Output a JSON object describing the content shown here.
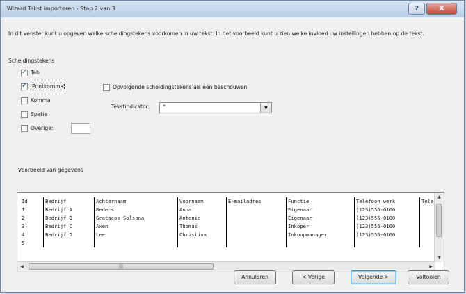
{
  "window": {
    "title": "Wizard Tekst importeren - Stap 2 van 3",
    "help_label": "?",
    "close_label": "X"
  },
  "description": "In dit venster kunt u opgeven welke scheidingstekens voorkomen in uw tekst. In het voorbeeld kunt u zien welke invloed uw instellingen hebben op de tekst.",
  "delimiters": {
    "group_label": "Scheidingstekens",
    "items": [
      {
        "label": "Tab",
        "checked": true
      },
      {
        "label": "Puntkomma",
        "checked": true
      },
      {
        "label": "Komma",
        "checked": false
      },
      {
        "label": "Spatie",
        "checked": false
      },
      {
        "label": "Overige:",
        "checked": false
      }
    ],
    "other_value": ""
  },
  "consecutive": {
    "label": "Opvolgende scheidingstekens als één beschouwen",
    "checked": false
  },
  "text_qualifier": {
    "label": "Tekstindicator:",
    "value": "\""
  },
  "preview": {
    "label": "Voorbeeld van gegevens",
    "columns": [
      {
        "cells": [
          "Id",
          "1",
          "2",
          "3",
          "4",
          "5"
        ]
      },
      {
        "cells": [
          "Bedrijf",
          "Bedrijf A",
          "Bedrijf B",
          "Bedrijf C",
          "Bedrijf D",
          ""
        ]
      },
      {
        "cells": [
          "Achternaam",
          "Bedecs",
          "Gratacos Solsona",
          "Axen",
          "Lee",
          ""
        ]
      },
      {
        "cells": [
          "Voornaam",
          "Anna",
          "Antonio",
          "Thomas",
          "Christina",
          ""
        ]
      },
      {
        "cells": [
          "E-mailadres",
          "",
          "",
          "",
          "",
          ""
        ]
      },
      {
        "cells": [
          "Functie",
          "Eigenaar",
          "Eigenaar",
          "Inkoper",
          "Inkoopmanager",
          ""
        ]
      },
      {
        "cells": [
          "Telefoon werk",
          "(123)555-0100",
          "(123)555-0100",
          "(123)555-0100",
          "(123)555-0100",
          ""
        ]
      },
      {
        "cells": [
          "Tele",
          "",
          "",
          "",
          "",
          ""
        ]
      }
    ]
  },
  "buttons": {
    "cancel": "Annuleren",
    "back": "< Vorige",
    "next": "Volgende >",
    "finish": "Voltooien"
  },
  "icons": {
    "dropdown": "chevron-down-icon",
    "scroll_up": "arrow-up-icon",
    "scroll_down": "arrow-down-icon",
    "scroll_left": "arrow-left-icon",
    "scroll_right": "arrow-right-icon"
  }
}
